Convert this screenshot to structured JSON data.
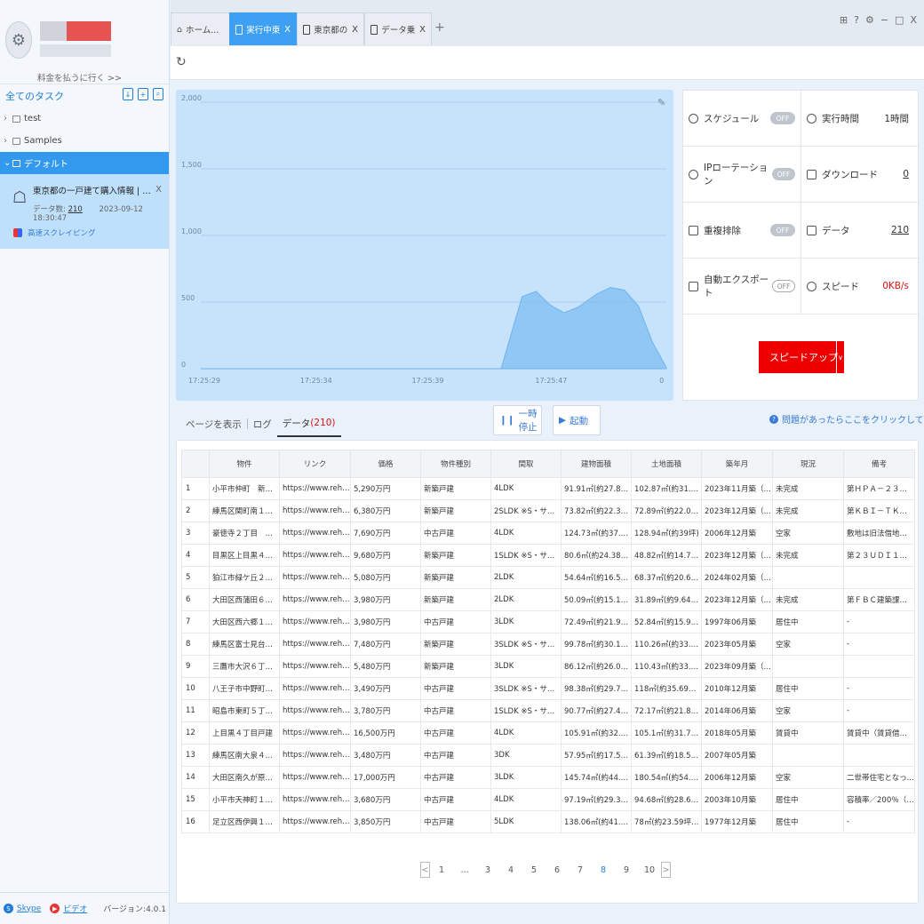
{
  "sidebar": {
    "pay_link": "料金を払うに行く >>",
    "tasks_heading": "全てのタスク",
    "tree": [
      {
        "label": "test"
      },
      {
        "label": "Samples"
      },
      {
        "label": "デフォルト"
      }
    ],
    "task": {
      "title": "東京都の一戸建て購入情報 | 三井のリハウ...",
      "count_label": "データ数:",
      "count": "210",
      "timestamp": "2023-09-12 18:30:47",
      "mode": "高速スクレイピング"
    },
    "footer": {
      "skype": "Skype",
      "video": "ビデオ",
      "version": "バージョン:4.0.1"
    }
  },
  "tabs": [
    {
      "label": "ホーム..."
    },
    {
      "label": "実行中東...",
      "close": "X"
    },
    {
      "label": "東京都の...",
      "close": "X"
    },
    {
      "label": "データ乗...",
      "close": "X"
    }
  ],
  "tab_plus": "+",
  "window_controls": [
    "⊞",
    "?",
    "⚙",
    "−",
    "□",
    "X"
  ],
  "stats": {
    "schedule": {
      "label": "スケジュール",
      "toggle": "OFF"
    },
    "runtime": {
      "label": "実行時間",
      "value": "1時間"
    },
    "ip_rotation": {
      "label": "IPローテーション",
      "toggle": "OFF"
    },
    "download": {
      "label": "ダウンロード",
      "value": "0"
    },
    "dedupe": {
      "label": "重複排除",
      "toggle": "OFF"
    },
    "data": {
      "label": "データ",
      "value": "210"
    },
    "auto_export": {
      "label": "自動エクスポート",
      "toggle": "OFF"
    },
    "speed": {
      "label": "スピード",
      "value": "0KB/s"
    },
    "speed_up_button": "スピードアップ"
  },
  "view_tabs": {
    "page": "ページを表示",
    "log": "ログ",
    "data": "データ",
    "data_count": "(210)"
  },
  "pause_button": "一時停止",
  "start_button": "起動",
  "help_link": "問題があったらここをクリックしてください",
  "colors": {
    "accent": "#3ea0f3",
    "danger": "#e00000",
    "chart_fill": "#7dbdf2"
  },
  "chart_data": {
    "type": "area",
    "x": [
      "17:25:29",
      "17:25:34",
      "17:25:39",
      "17:25:47",
      "0"
    ],
    "yticks": [
      "2,000",
      "1,500",
      "1,000",
      "500",
      "0"
    ],
    "ylim": [
      0,
      2000
    ],
    "points": [
      [
        0,
        0
      ],
      [
        0.3,
        0
      ],
      [
        0.6,
        0
      ],
      [
        0.645,
        0
      ],
      [
        0.69,
        540
      ],
      [
        0.72,
        580
      ],
      [
        0.75,
        480
      ],
      [
        0.78,
        420
      ],
      [
        0.81,
        460
      ],
      [
        0.85,
        560
      ],
      [
        0.88,
        610
      ],
      [
        0.91,
        590
      ],
      [
        0.94,
        470
      ],
      [
        0.97,
        200
      ],
      [
        1.0,
        10
      ]
    ],
    "title": "",
    "xlabel": "",
    "ylabel": ""
  },
  "table": {
    "headers": [
      "",
      "物件",
      "リンク",
      "価格",
      "物件種別",
      "間取",
      "建物面積",
      "土地面積",
      "築年月",
      "現況",
      "備考"
    ],
    "rows": [
      [
        "1",
        "小平市仲町　新築戸建...",
        "https://www.rehouse.co...",
        "5,290万円",
        "新築戸建",
        "4LDK",
        "91.91㎡(約27.80坪)",
        "102.87㎡(約31.11坪)",
        "2023年11月築（予定）",
        "未完成",
        "第ＨＰＡ－２３－０８..."
      ],
      [
        "2",
        "練馬区関町南１丁目　...",
        "https://www.rehouse.co...",
        "6,380万円",
        "新築戸建",
        "2SLDK ※S・サービス...",
        "73.82㎡(約22.33坪)",
        "72.89㎡(約22.04坪)",
        "2023年12月築（予定）",
        "未完成",
        "第ＫＢＩ－ＴＫＮ２３..."
      ],
      [
        "3",
        "豪徳寺２丁目　戸建",
        "https://www.rehouse.co...",
        "7,690万円",
        "中古戸建",
        "4LDK",
        "124.73㎡(約37.73坪)",
        "128.94㎡(約39坪)",
        "2006年12月築",
        "空家",
        "敷地は旧法借地権（借..."
      ],
      [
        "4",
        "目黒区上目黒４丁目　...",
        "https://www.rehouse.co...",
        "9,680万円",
        "新築戸建",
        "1SLDK ※S・サービス...",
        "80.6㎡(約24.38坪)",
        "48.82㎡(約14.76坪) ※...",
        "2023年12月築（予定）",
        "未完成",
        "第２３ＵＤＩ１Ｃ建０..."
      ],
      [
        "5",
        "狛江市緑ケ丘２丁目　...",
        "https://www.rehouse.co...",
        "5,080万円",
        "新築戸建",
        "2LDK",
        "54.64㎡(約16.52坪)",
        "68.37㎡(約20.68坪) ※...",
        "2024年02月築（予定）",
        "",
        ""
      ],
      [
        "6",
        "大田区西蒲田６丁目　...",
        "https://www.rehouse.co...",
        "3,980万円",
        "新築戸建",
        "2LDK",
        "50.09㎡(約15.15坪)",
        "31.89㎡(約9.64坪) ※...",
        "2023年12月築（予定）",
        "未完成",
        "第ＦＢＣ建築課２３－..."
      ],
      [
        "7",
        "大田区西六郷１丁目　...",
        "https://www.rehouse.co...",
        "3,980万円",
        "中古戸建",
        "3LDK",
        "72.49㎡(約21.92坪)",
        "52.84㎡(約15.98坪)",
        "1997年06月築",
        "居住中",
        "-"
      ],
      [
        "8",
        "練馬区富士見台４丁目...",
        "https://www.rehouse.co...",
        "7,480万円",
        "新築戸建",
        "3SLDK ※S・サービス...",
        "99.78㎡(約30.18坪)",
        "110.26㎡(約33.35坪)",
        "2023年05月築",
        "空家",
        "-"
      ],
      [
        "9",
        "三鷹市大沢６丁目　新...",
        "https://www.rehouse.co...",
        "5,480万円",
        "新築戸建",
        "3LDK",
        "86.12㎡(約26.05坪)",
        "110.43㎡(約33.4坪)",
        "2023年09月築（予定）",
        "",
        ""
      ],
      [
        "10",
        "八王子市中野町　戸建",
        "https://www.rehouse.co...",
        "3,490万円",
        "中古戸建",
        "3SLDK ※S・サービス...",
        "98.38㎡(約29.75坪)",
        "118㎡(約35.69坪) ※...",
        "2010年12月築",
        "居住中",
        "-"
      ],
      [
        "11",
        "昭島市東町５丁目　戸建",
        "https://www.rehouse.co...",
        "3,780万円",
        "中古戸建",
        "1SLDK ※S・サービス...",
        "90.77㎡(約27.45坪)",
        "72.17㎡(約21.83坪)",
        "2014年06月築",
        "空家",
        "-"
      ],
      [
        "12",
        "上目黒４丁目戸建",
        "https://www.rehouse.co...",
        "16,500万円",
        "中古戸建",
        "4LDK",
        "105.91㎡(約32.03坪)",
        "105.1㎡(約31.79坪) ※...",
        "2018年05月築",
        "賃貸中",
        "賃貸中（賃貸借契約引..."
      ],
      [
        "13",
        "練馬区南大泉４丁目　...",
        "https://www.rehouse.co...",
        "3,480万円",
        "中古戸建",
        "3DK",
        "57.95㎡(約17.52坪)",
        "61.39㎡(約18.57坪)",
        "2007年05月築",
        "",
        ""
      ],
      [
        "14",
        "大田区南久が原二丁目...",
        "https://www.rehouse.co...",
        "17,000万円",
        "中古戸建",
        "3LDK",
        "145.74㎡(約44.08坪)",
        "180.54㎡(約54.61坪)",
        "2006年12月築",
        "空家",
        "二世帯住宅となってお..."
      ],
      [
        "15",
        "小平市天神町１丁目　...",
        "https://www.rehouse.co...",
        "3,680万円",
        "中古戸建",
        "4LDK",
        "97.19㎡(約29.39坪)",
        "94.68㎡(約28.64坪) ※...",
        "2003年10月築",
        "居住中",
        "容積率／200％（但し、..."
      ],
      [
        "16",
        "足立区西伊興１丁目",
        "https://www.rehouse.co...",
        "3,850万円",
        "中古戸建",
        "5LDK",
        "138.06㎡(約41.76坪)",
        "78㎡(約23.59坪) ※到...",
        "1977年12月築",
        "居住中",
        "-"
      ]
    ]
  },
  "pager": {
    "prev": "<",
    "pages": [
      "1",
      "...",
      "3",
      "4",
      "5",
      "6",
      "7",
      "8",
      "9",
      "10"
    ],
    "current": "8",
    "next": ">"
  }
}
